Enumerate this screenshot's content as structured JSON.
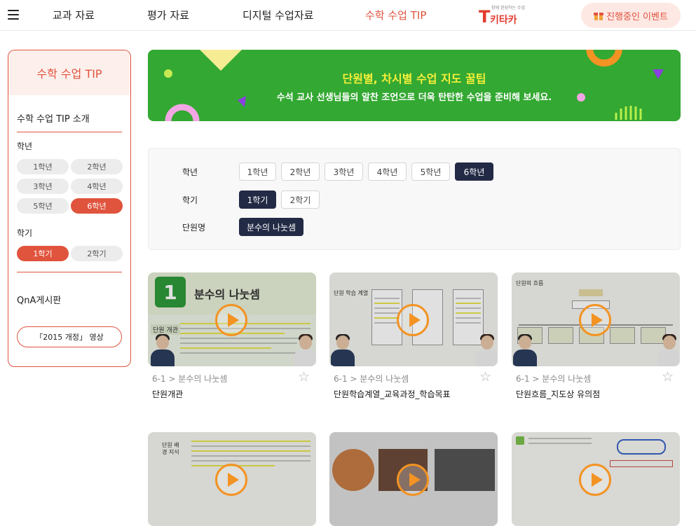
{
  "header": {
    "nav": [
      "교과 자료",
      "평가 자료",
      "디지털 수업자료",
      "수학 수업 TIP"
    ],
    "active_nav": "수학 수업 TIP",
    "logo": {
      "sub": "함께 완성하는 수업",
      "word": "키타카"
    },
    "event_button": "진행중인 이벤트"
  },
  "sidebar": {
    "title": "수학 수업 TIP",
    "intro_link": "수학 수업 TIP 소개",
    "grade_label": "학년",
    "grades": [
      "1학년",
      "2학년",
      "3학년",
      "4학년",
      "5학년",
      "6학년"
    ],
    "selected_grade": "6학년",
    "semester_label": "학기",
    "semesters": [
      "1학기",
      "2학기"
    ],
    "selected_semester": "1학기",
    "qna_link": "QnA게시판",
    "video_button": "「2015 개정」 영상"
  },
  "banner": {
    "title": "단원별, 차시별 수업 지도 꿀팁",
    "subtitle": "수석 교사 선생님들의 알찬 조언으로 더욱 탄탄한 수업을 준비해 보세요."
  },
  "filter": {
    "grade_label": "학년",
    "grades": [
      "1학년",
      "2학년",
      "3학년",
      "4학년",
      "5학년",
      "6학년"
    ],
    "selected_grade": "6학년",
    "semester_label": "학기",
    "semesters": [
      "1학기",
      "2학기"
    ],
    "selected_semester": "1학기",
    "unit_label": "단원명",
    "units": [
      "분수의 나눗셈"
    ],
    "selected_unit": "분수의 나눗셈"
  },
  "cards": [
    {
      "category": "6-1 > 분수의 나눗셈",
      "title": "단원개관",
      "thumb_number": "1",
      "thumb_heading": "분수의 나눗셈",
      "thumb_tag": "단원 개관"
    },
    {
      "category": "6-1 > 분수의 나눗셈",
      "title": "단원학습계열_교육과정_학습목표",
      "thumb_tag": "단원 학습 계열"
    },
    {
      "category": "6-1 > 분수의 나눗셈",
      "title": "단원흐름_지도상 유의점",
      "thumb_tag": "단원의 흐름"
    },
    {
      "category": "",
      "title": "",
      "thumb_tag": "단원 배경 지식"
    },
    {
      "category": "",
      "title": "",
      "thumb_tag": ""
    },
    {
      "category": "",
      "title": "",
      "thumb_tag": ""
    }
  ],
  "colors": {
    "accent": "#e0533d",
    "banner": "#33a832",
    "dark_chip": "#232a45",
    "play": "#f39323"
  }
}
